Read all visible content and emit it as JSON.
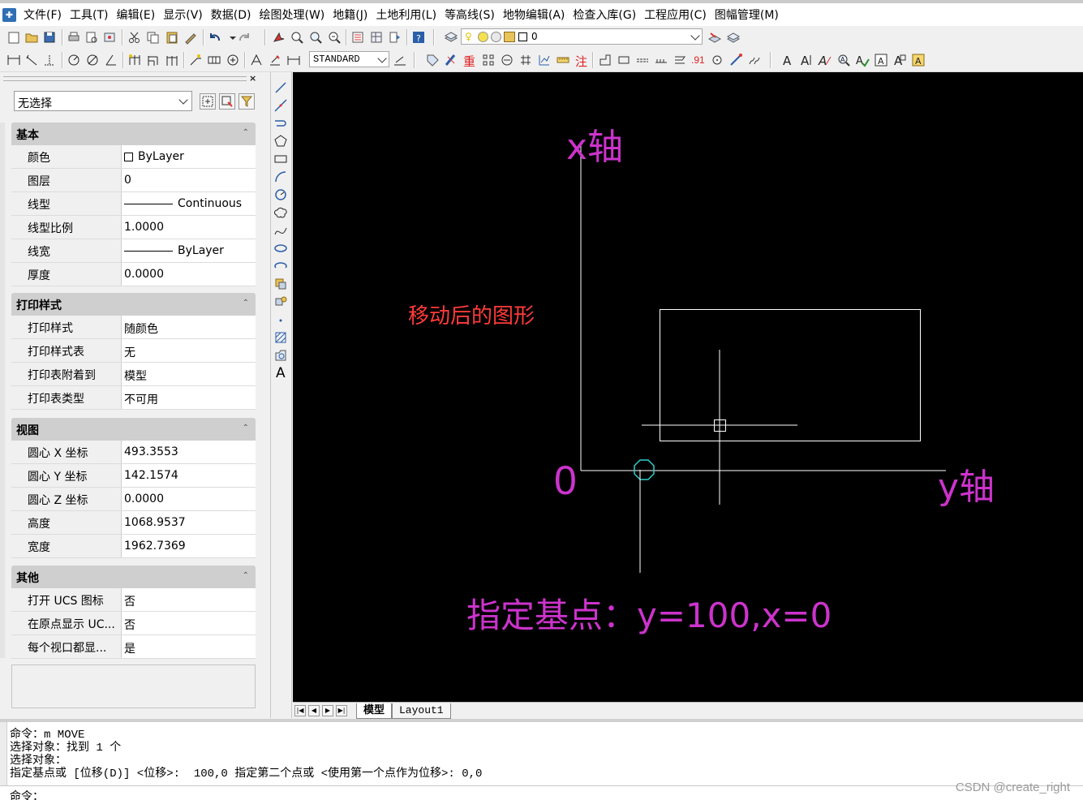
{
  "menubar": {
    "items": [
      "文件(F)",
      "工具(T)",
      "编辑(E)",
      "显示(V)",
      "数据(D)",
      "绘图处理(W)",
      "地籍(J)",
      "土地利用(L)",
      "等高线(S)",
      "地物编辑(A)",
      "检查入库(G)",
      "工程应用(C)",
      "图幅管理(M)"
    ]
  },
  "toolbar": {
    "layer_value": "0",
    "text_style_value": "STANDARD",
    "red_labels": [
      "重",
      "注",
      ".91"
    ]
  },
  "properties": {
    "selection_value": "无选择",
    "sections": [
      {
        "title": "基本",
        "rows": [
          {
            "key": "颜色",
            "value": "ByLayer"
          },
          {
            "key": "图层",
            "value": "0"
          },
          {
            "key": "线型",
            "value": "Continuous"
          },
          {
            "key": "线型比例",
            "value": "1.0000"
          },
          {
            "key": "线宽",
            "value": "ByLayer"
          },
          {
            "key": "厚度",
            "value": "0.0000"
          }
        ]
      },
      {
        "title": "打印样式",
        "rows": [
          {
            "key": "打印样式",
            "value": "随颜色"
          },
          {
            "key": "打印样式表",
            "value": "无"
          },
          {
            "key": "打印表附着到",
            "value": "模型"
          },
          {
            "key": "打印表类型",
            "value": "不可用"
          }
        ]
      },
      {
        "title": "视图",
        "rows": [
          {
            "key": "圆心 X 坐标",
            "value": "493.3553"
          },
          {
            "key": "圆心 Y 坐标",
            "value": "142.1574"
          },
          {
            "key": "圆心 Z 坐标",
            "value": "0.0000"
          },
          {
            "key": "高度",
            "value": "1068.9537"
          },
          {
            "key": "宽度",
            "value": "1962.7369"
          }
        ]
      },
      {
        "title": "其他",
        "rows": [
          {
            "key": "打开 UCS 图标",
            "value": "否"
          },
          {
            "key": "在原点显示 UC...",
            "value": "否"
          },
          {
            "key": "每个视口都显...",
            "value": "是"
          }
        ]
      }
    ]
  },
  "drawbar": {
    "text_tool": "A"
  },
  "canvas": {
    "x_axis_label": "x轴",
    "y_axis_label": "y轴",
    "origin_label": "0",
    "annotation": "移动后的图形",
    "base_point_note": "指定基点：y=100,x=0",
    "colors": {
      "background": "#000000",
      "axis": "#ffffff",
      "label": "#cc33cc",
      "annotation": "#ff3a3a",
      "marker": "#33cccc"
    }
  },
  "tabs": {
    "items": [
      "模型",
      "Layout1"
    ],
    "active": "模型"
  },
  "command": {
    "lines": [
      "命令：m MOVE",
      "选择对象：找到 1 个",
      "选择对象：",
      "指定基点或 [位移(D)] <位移>:  100,0 指定第二个点或 <使用第一个点作为位移>: 0,0"
    ],
    "prompt": "命令：",
    "watermark": "CSDN @create_right"
  }
}
